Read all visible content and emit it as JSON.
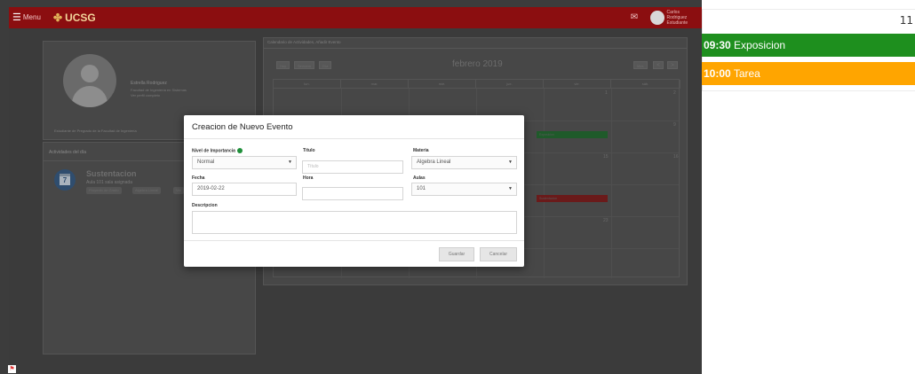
{
  "topbar": {
    "menu_icon": "hamburger-icon",
    "menu_label": "Menu",
    "logo_icon": "ucsg-emblem-icon",
    "logo_text": "UCSG",
    "bell_icon": "bell-icon",
    "user_line1": "Carlos Rodriguez",
    "user_line2": "Estudiante",
    "bar_color": "#8b0e10"
  },
  "profile": {
    "name": "Estrella Rodriguez",
    "line1": "Facultad de Ingeniería en Sistemas",
    "line2": "Ver perfil completo",
    "footer": "Estudiante de Pregrado de la Facultad de Ingeniería"
  },
  "activities": {
    "title": "Actividades del día",
    "calendar_day": "7",
    "item_title": "Sustentacion",
    "item_sub": "Aula 101 sala asignada",
    "tags": [
      "Proyecto de Grado",
      "Algebra Lineal",
      "Ver"
    ]
  },
  "calendar": {
    "heading": "Calendario de Actividades, Añadir Evento",
    "nav_buttons": [
      "Hoy",
      "Semana",
      "Día"
    ],
    "month": "febrero 2019",
    "view_buttons": [
      "Mes",
      "<",
      ">"
    ],
    "day_headers": [
      "lun.",
      "mar.",
      "mié.",
      "jue.",
      "vie.",
      "sáb."
    ],
    "day_numbers": [
      "1",
      "2",
      "9",
      "16",
      "15",
      "23"
    ],
    "events": [
      {
        "label": "Exposicion",
        "color": "#1f8f3a"
      },
      {
        "label": "Sustentacion",
        "color": "#c01313"
      }
    ]
  },
  "modal": {
    "title": "Creacion de Nuevo Evento",
    "importance_label": "Nivel de Importancia",
    "importance_value": "Normal",
    "titulo_label": "Título",
    "titulo_placeholder": "Título",
    "materia_label": "Materia",
    "materia_value": "Algebra Lineal",
    "fecha_label": "Fecha",
    "fecha_value": "2019-02-22",
    "hora_label": "Hora",
    "aulas_label": "Aulas",
    "aulas_value": "101",
    "descripcion_label": "Descripcion",
    "save_label": "Guardar",
    "cancel_label": "Cancelar",
    "importance_color": "#1f8f3a"
  },
  "stamp_icon": "flag-icon",
  "side_panel": {
    "day_number": "11",
    "events": [
      {
        "time": "09:30",
        "title": "Exposicion",
        "color": "#1e8f1e"
      },
      {
        "time": "10:00",
        "title": "Tarea",
        "color": "#ffa500"
      }
    ]
  }
}
